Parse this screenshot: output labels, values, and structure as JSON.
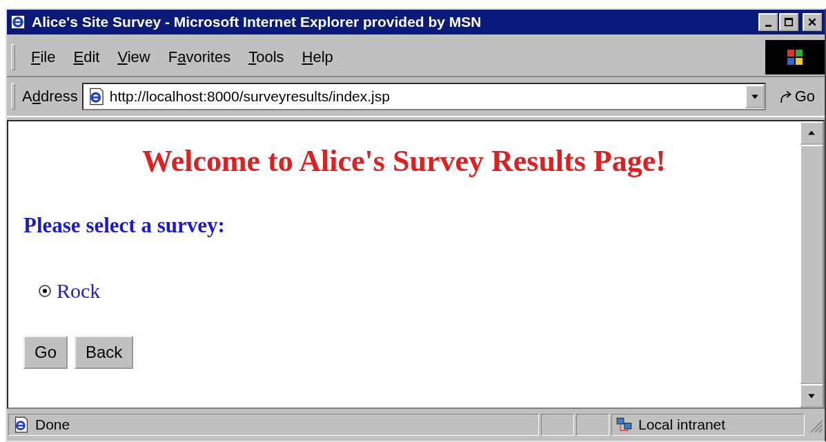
{
  "window": {
    "title": "Alice's Site Survey - Microsoft Internet Explorer provided by MSN"
  },
  "menu": [
    {
      "key": "F",
      "post": "ile"
    },
    {
      "key": "E",
      "post": "dit"
    },
    {
      "key": "V",
      "post": "iew"
    },
    {
      "pre": "F",
      "key": "a",
      "post": "vorites"
    },
    {
      "key": "T",
      "post": "ools"
    },
    {
      "key": "H",
      "post": "elp"
    }
  ],
  "address_bar": {
    "label": {
      "pre": "A",
      "key": "d",
      "post": "dress"
    },
    "value": "http://localhost:8000/surveyresults/index.jsp",
    "go": "Go"
  },
  "page": {
    "heading": "Welcome to Alice's Survey Results Page!",
    "prompt": "Please select a survey:",
    "options": [
      {
        "label": "Rock",
        "selected": true
      }
    ],
    "buttons": [
      "Go",
      "Back"
    ]
  },
  "status_bar": {
    "text": "Done",
    "zone": "Local intranet"
  }
}
